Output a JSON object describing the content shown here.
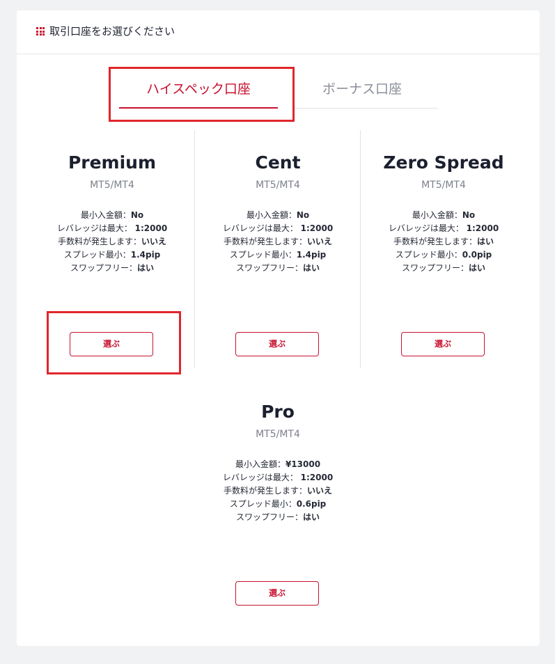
{
  "header": {
    "title": "取引口座をお選びください",
    "icon": "grid-icon"
  },
  "tabs": [
    {
      "label": "ハイスペック口座",
      "active": true
    },
    {
      "label": "ボーナス口座",
      "active": false
    }
  ],
  "accounts": [
    {
      "name": "Premium",
      "platform": "MT5/MT4",
      "features": [
        {
          "label": "最小入金額：",
          "value": "No"
        },
        {
          "label": "レバレッジは最大： ",
          "value": "1:2000"
        },
        {
          "label": "手数料が発生します：",
          "value": "いいえ"
        },
        {
          "label": "スプレッド最小：",
          "value": "1.4pip"
        },
        {
          "label": "スワップフリー：",
          "value": "はい"
        }
      ],
      "button_label": "選ぶ"
    },
    {
      "name": "Cent",
      "platform": "MT5/MT4",
      "features": [
        {
          "label": "最小入金額：",
          "value": "No"
        },
        {
          "label": "レバレッジは最大： ",
          "value": "1:2000"
        },
        {
          "label": "手数料が発生します：",
          "value": "いいえ"
        },
        {
          "label": "スプレッド最小：",
          "value": "1.4pip"
        },
        {
          "label": "スワップフリー：",
          "value": "はい"
        }
      ],
      "button_label": "選ぶ"
    },
    {
      "name": "Zero Spread",
      "platform": "MT5/MT4",
      "features": [
        {
          "label": "最小入金額：",
          "value": "No"
        },
        {
          "label": "レバレッジは最大： ",
          "value": "1:2000"
        },
        {
          "label": "手数料が発生します：",
          "value": "はい"
        },
        {
          "label": "スプレッド最小：",
          "value": "0.0pip"
        },
        {
          "label": "スワップフリー：",
          "value": "はい"
        }
      ],
      "button_label": "選ぶ"
    },
    {
      "name": "Pro",
      "platform": "MT5/MT4",
      "features": [
        {
          "label": "最小入金額：",
          "value": "¥13000"
        },
        {
          "label": "レバレッジは最大： ",
          "value": "1:2000"
        },
        {
          "label": "手数料が発生します：",
          "value": "いいえ"
        },
        {
          "label": "スプレッド最小：",
          "value": "0.6pip"
        },
        {
          "label": "スワップフリー：",
          "value": "はい"
        }
      ],
      "button_label": "選ぶ"
    }
  ],
  "colors": {
    "accent": "#c8102e",
    "highlight": "#e0262b",
    "muted_text": "#8a8e99",
    "background": "#f1f2f4"
  }
}
